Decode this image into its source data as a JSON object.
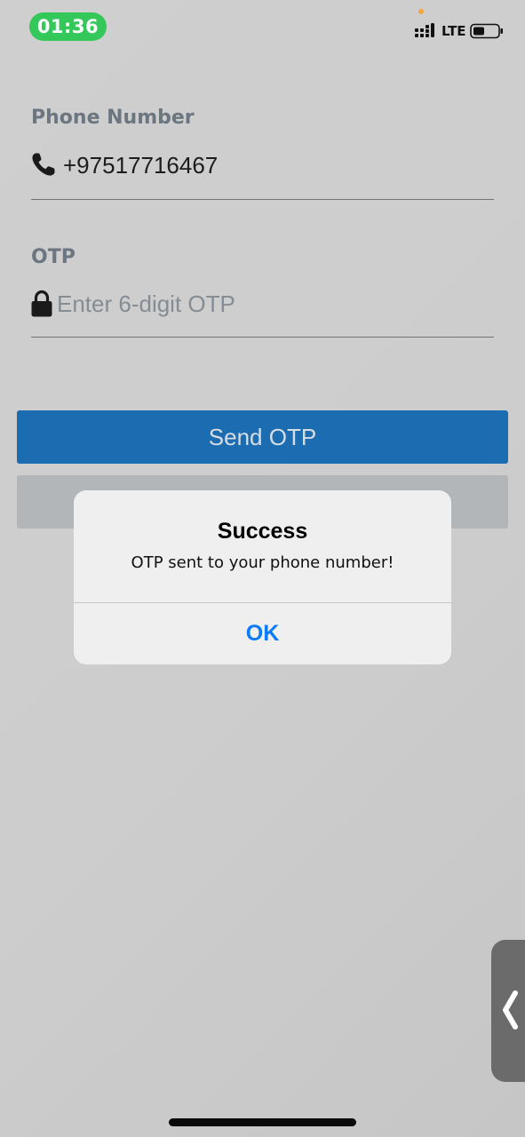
{
  "status_bar": {
    "time": "01:36",
    "network": "LTE",
    "icons": [
      "signal-icon",
      "battery-icon"
    ],
    "colors": {
      "time_pill": "#34c759",
      "privacy_dot": "#f2a53a"
    }
  },
  "form": {
    "phone": {
      "label": "Phone Number",
      "value": "+97517716467",
      "icon": "phone-icon"
    },
    "otp": {
      "label": "OTP",
      "placeholder": "Enter 6-digit OTP",
      "icon": "lock-icon"
    },
    "send_button_label": "Send OTP"
  },
  "alert": {
    "title": "Success",
    "message": "OTP sent to your phone number!",
    "ok_label": "OK"
  },
  "side_handle": {
    "icon": "chevron-left-icon"
  },
  "colors": {
    "primary_button": "#1c6cb2",
    "alert_action": "#0a7aff",
    "label_gray": "#6c7680"
  }
}
